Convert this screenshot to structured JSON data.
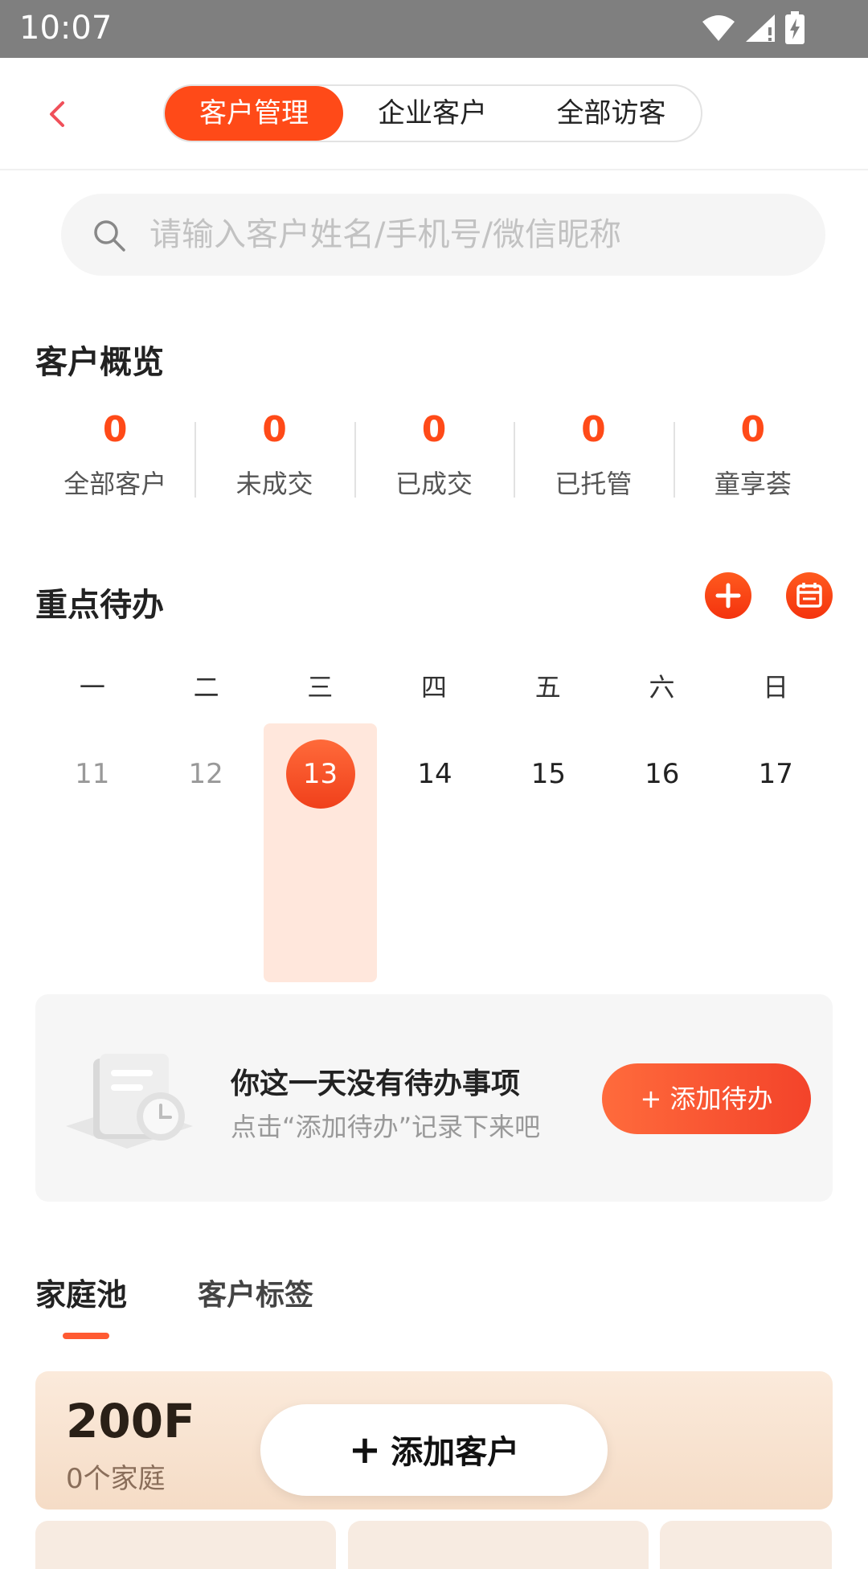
{
  "status_bar": {
    "time": "10:07"
  },
  "nav": {
    "tabs": [
      {
        "label": "客户管理",
        "active": true
      },
      {
        "label": "企业客户",
        "active": false
      },
      {
        "label": "全部访客",
        "active": false
      }
    ]
  },
  "search": {
    "placeholder": "请输入客户姓名/手机号/微信昵称"
  },
  "overview": {
    "title": "客户概览",
    "stats": [
      {
        "value": "0",
        "label": "全部客户"
      },
      {
        "value": "0",
        "label": "未成交"
      },
      {
        "value": "0",
        "label": "已成交"
      },
      {
        "value": "0",
        "label": "已托管"
      },
      {
        "value": "0",
        "label": "童享荟"
      }
    ]
  },
  "todo": {
    "title": "重点待办",
    "weekdays": [
      "一",
      "二",
      "三",
      "四",
      "五",
      "六",
      "日"
    ],
    "dates": [
      "11",
      "12",
      "13",
      "14",
      "15",
      "16",
      "17"
    ],
    "today_index": 2,
    "empty_title": "你这一天没有待办事项",
    "empty_subtitle": "点击“添加待办”记录下来吧",
    "add_button": "+ 添加待办"
  },
  "family": {
    "tabs": [
      {
        "label": "家庭池",
        "active": true
      },
      {
        "label": "客户标签",
        "active": false
      }
    ],
    "pool": {
      "name": "200F",
      "count": "0个家庭"
    },
    "add_customer": "添加客户"
  },
  "colors": {
    "accent": "#ff4a18",
    "today_bg": "#ffe7dc",
    "card_bg": "#f6f6f6"
  }
}
